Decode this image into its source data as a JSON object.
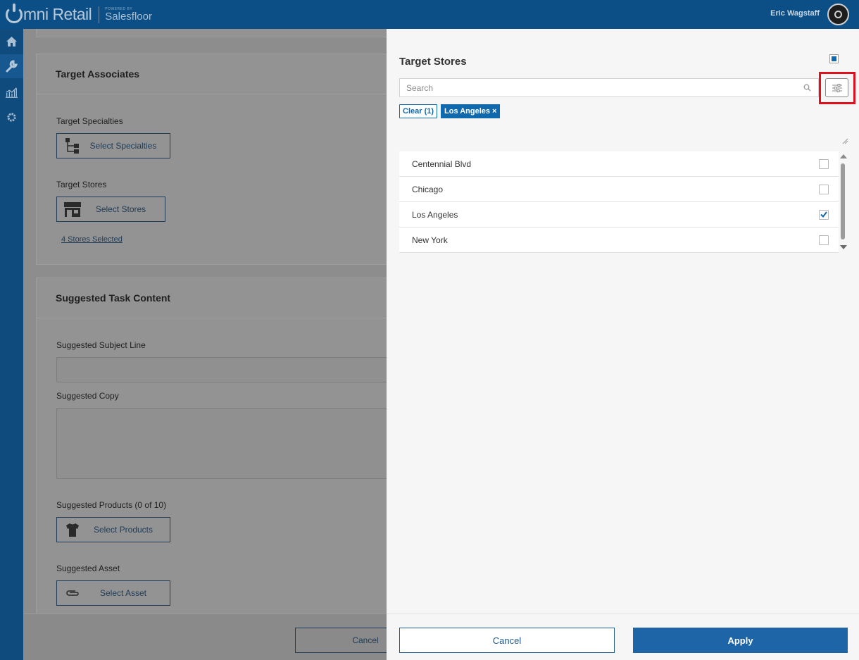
{
  "app": {
    "brand": "mni Retail",
    "powered_by": "POWERED BY",
    "powered_brand": "Salesfloor",
    "user_name": "Eric Wagstaff"
  },
  "nav": {
    "items": [
      {
        "name": "home",
        "icon": "home-icon"
      },
      {
        "name": "tools",
        "icon": "wrench-icon",
        "active": true
      },
      {
        "name": "reports",
        "icon": "chart-icon"
      },
      {
        "name": "settings",
        "icon": "gear-icon"
      }
    ]
  },
  "background": {
    "target_associates": {
      "title": "Target Associates",
      "specialties_label": "Target Specialties",
      "specialties_button": "Select Specialties",
      "stores_label": "Target Stores",
      "stores_button": "Select Stores",
      "stores_selected": "4 Stores Selected"
    },
    "suggested_content": {
      "title": "Suggested Task Content",
      "subject_label": "Suggested Subject Line",
      "copy_label": "Suggested Copy",
      "products_label": "Suggested Products (0 of 10)",
      "products_button": "Select Products",
      "asset_label": "Suggested Asset",
      "asset_button": "Select Asset"
    },
    "cancel_label": "Cancel"
  },
  "panel": {
    "title": "Target Stores",
    "search_placeholder": "Search",
    "clear_label": "Clear (1)",
    "active_filter": "Los Angeles",
    "remove_symbol": "×",
    "stores": [
      {
        "name": "Centennial Blvd",
        "checked": false
      },
      {
        "name": "Chicago",
        "checked": false
      },
      {
        "name": "Los Angeles",
        "checked": true
      },
      {
        "name": "New York",
        "checked": false
      }
    ],
    "cancel_label": "Cancel",
    "apply_label": "Apply"
  },
  "colors": {
    "header": "#0b4f86",
    "accent": "#1169ad",
    "highlight": "#e1101f"
  }
}
